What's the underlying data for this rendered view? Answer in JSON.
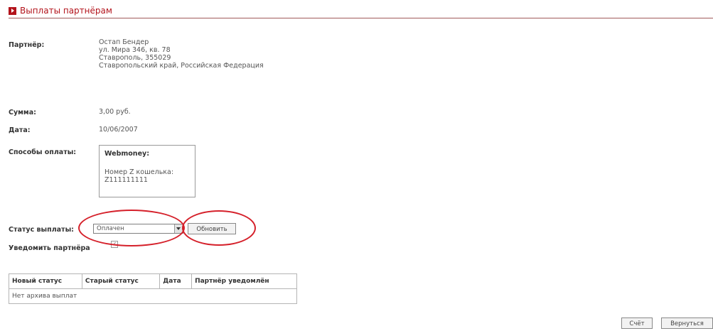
{
  "header": {
    "title": "Выплаты партнёрам",
    "accent_color": "#b3131b",
    "icon": "play-square-icon"
  },
  "partner": {
    "label": "Партнёр:",
    "name": "Остап Бендер",
    "address_lines": [
      "ул. Мира 346, кв. 78",
      "Ставрополь, 355029",
      "Ставропольский край, Российская Федерация"
    ]
  },
  "amount": {
    "label": "Сумма:",
    "value": "3,00 руб."
  },
  "date": {
    "label": "Дата:",
    "value": "10/06/2007"
  },
  "payment_methods": {
    "label": "Способы оплаты:",
    "method": "Webmoney:",
    "wallet_label": "Номер Z кошелька:",
    "wallet_value": "Z111111111"
  },
  "status": {
    "label": "Статус выплаты:",
    "selected": "Оплачен",
    "update_button": "Обновить"
  },
  "notify": {
    "label": "Уведомить партнёра",
    "checked": true
  },
  "history": {
    "columns": [
      "Новый статус",
      "Старый статус",
      "Дата",
      "Партнёр уведомлён"
    ],
    "empty_text": "Нет архива выплат"
  },
  "footer": {
    "invoice_button": "Счёт",
    "back_button": "Вернуться"
  },
  "highlight_color": "#d5202a"
}
